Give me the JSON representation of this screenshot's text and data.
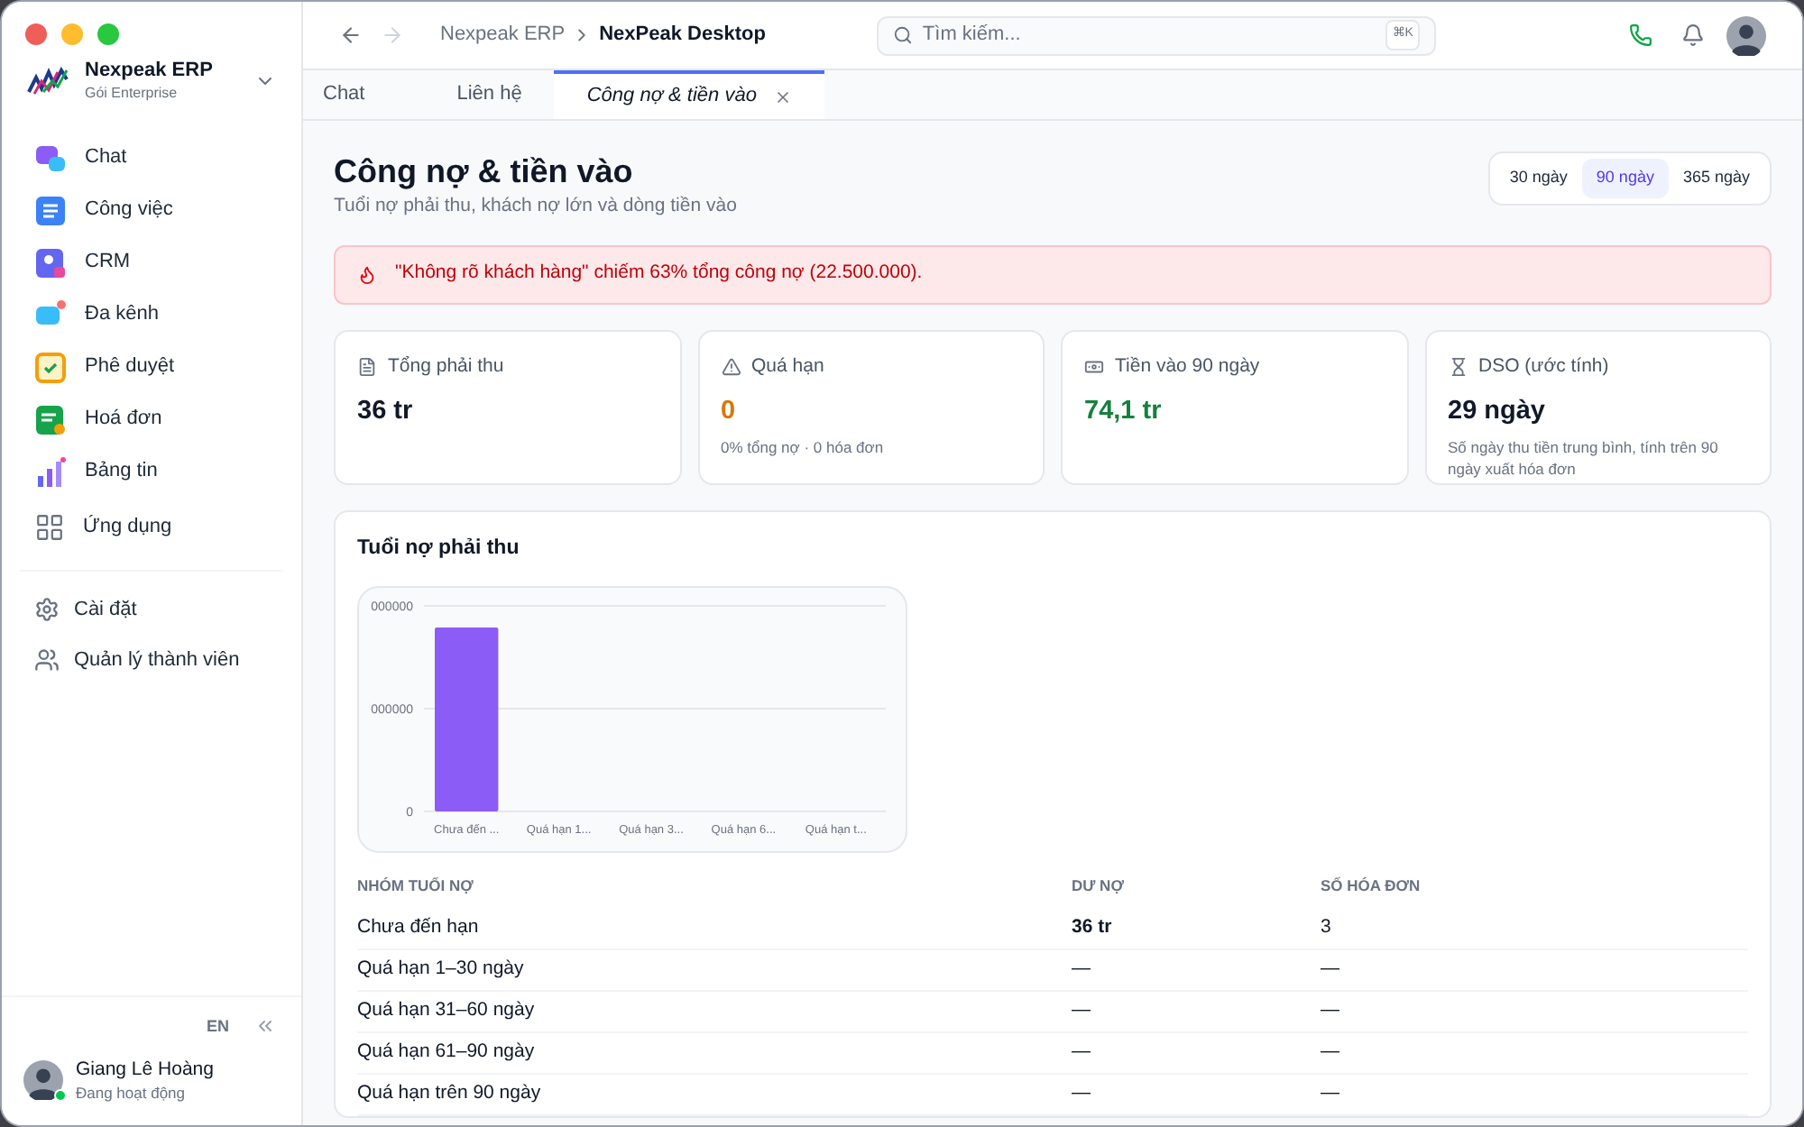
{
  "sidebar": {
    "workspace": {
      "name": "Nexpeak ERP",
      "plan": "Gói Enterprise"
    },
    "nav": [
      {
        "label": "Chat",
        "selected": false
      },
      {
        "label": "Công việc",
        "selected": false
      },
      {
        "label": "CRM",
        "selected": false
      },
      {
        "label": "Đa kênh",
        "selected": false
      },
      {
        "label": "Phê duyệt",
        "selected": false
      },
      {
        "label": "Hoá đơn",
        "selected": false
      },
      {
        "label": "Bảng tin",
        "selected": false
      },
      {
        "label": "Ứng dụng",
        "selected": false
      }
    ],
    "settings": [
      {
        "label": "Cài đặt",
        "selected": false
      },
      {
        "label": "Quản lý thành viên",
        "selected": false
      }
    ],
    "language": "EN",
    "user": {
      "name": "Giang Lê Hoàng",
      "status": "Đang hoạt động",
      "online": true
    }
  },
  "topbar": {
    "breadcrumb": [
      "Nexpeak ERP",
      "NexPeak Desktop"
    ],
    "search": {
      "placeholder": "Tìm kiếm...",
      "shortcut": "⌘K"
    }
  },
  "tabs": [
    {
      "label": "Chat",
      "selected": false,
      "closable": false
    },
    {
      "label": "Liên hệ",
      "selected": false,
      "closable": false
    },
    {
      "label": "Công nợ & tiền vào",
      "selected": true,
      "closable": true
    }
  ],
  "page": {
    "title": "Công nợ & tiền vào",
    "subtitle": "Tuổi nợ phải thu, khách nợ lớn và dòng tiền vào",
    "ranges": [
      {
        "label": "30 ngày",
        "selected": false
      },
      {
        "label": "90 ngày",
        "selected": true
      },
      {
        "label": "365 ngày",
        "selected": false
      }
    ],
    "alert": "\"Không rõ khách hàng\" chiếm 63% tổng công nợ (22.500.000).",
    "stats": [
      {
        "label": "Tổng phải thu",
        "value": "36 tr",
        "color": "#111827"
      },
      {
        "label": "Quá hạn",
        "value": "0",
        "color": "#d97706",
        "note": "0% tổng nợ · 0 hóa đơn"
      },
      {
        "label": "Tiền vào 90 ngày",
        "value": "74,1 tr",
        "color": "#15803d"
      },
      {
        "label": "DSO (ước tính)",
        "value": "29 ngày",
        "color": "#111827",
        "note": "Số ngày thu tiền trung bình, tính trên 90 ngày xuất hóa đơn"
      }
    ],
    "aging": {
      "title": "Tuổi nợ phải thu",
      "chart": {
        "y_labels": [
          "000000",
          "000000",
          "0"
        ],
        "x_labels": [
          "Chưa đến ...",
          "Quá hạn 1...",
          "Quá hạn 3...",
          "Quá hạn 6...",
          "Quá hạn t..."
        ]
      },
      "columns": [
        "NHÓM TUỔI NỢ",
        "DƯ NỢ",
        "SỐ HÓA ĐƠN"
      ],
      "rows": [
        [
          "Chưa đến hạn",
          "36 tr",
          "3"
        ],
        [
          "Quá hạn 1–30 ngày",
          "—",
          "—"
        ],
        [
          "Quá hạn 31–60 ngày",
          "—",
          "—"
        ],
        [
          "Quá hạn 61–90 ngày",
          "—",
          "—"
        ],
        [
          "Quá hạn trên 90 ngày",
          "—",
          "—"
        ]
      ]
    }
  }
}
